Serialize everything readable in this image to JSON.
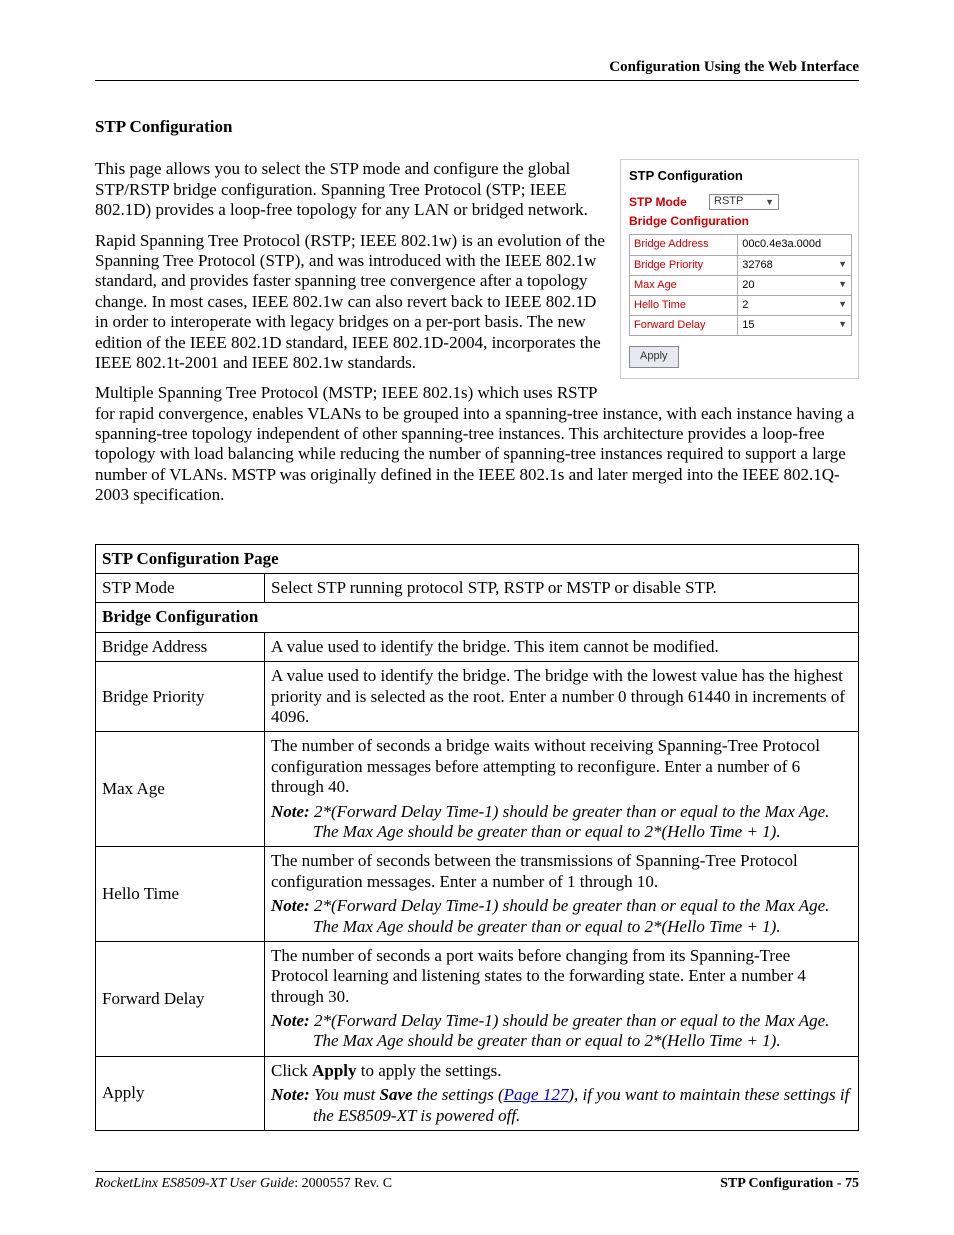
{
  "header": {
    "text": "Configuration Using the Web Interface"
  },
  "heading": "STP Configuration",
  "paragraphs": {
    "p1": "This page allows you to select the STP mode and configure the global STP/RSTP bridge configuration. Spanning Tree Protocol (STP; IEEE 802.1D) provides a loop-free topology for any LAN or bridged network.",
    "p2": "Rapid Spanning Tree Protocol (RSTP; IEEE 802.1w) is an evolution of the Spanning Tree Protocol (STP), and was introduced with the IEEE 802.1w standard, and provides faster spanning tree convergence after a topology change. In most cases, IEEE 802.1w can also revert back to IEEE 802.1D in order to interoperate with legacy bridges on a per-port basis. The new edition of the IEEE 802.1D standard, IEEE 802.1D-2004, incorporates the IEEE 802.1t-2001 and IEEE 802.1w standards.",
    "p3": "Multiple Spanning Tree Protocol (MSTP; IEEE 802.1s) which uses RSTP for rapid convergence, enables VLANs to be grouped into a spanning-tree instance, with each instance having a spanning-tree topology independent of other spanning-tree instances. This architecture provides a loop-free topology with load balancing while reducing the number of spanning-tree instances required to support a large number of VLANs. MSTP was originally defined in the IEEE 802.1s and later merged into the IEEE 802.1Q-2003 specification."
  },
  "figure": {
    "title": "STP Configuration",
    "mode_label": "STP Mode",
    "mode_value": "RSTP",
    "bridge_hdr": "Bridge Configuration",
    "rows": {
      "addr_label": "Bridge Address",
      "addr_value": "00c0.4e3a.000d",
      "prio_label": "Bridge Priority",
      "prio_value": "32768",
      "maxage_label": "Max Age",
      "maxage_value": "20",
      "hello_label": "Hello Time",
      "hello_value": "2",
      "fwd_label": "Forward Delay",
      "fwd_value": "15"
    },
    "apply": "Apply"
  },
  "table": {
    "title": "STP Configuration Page",
    "stp_mode": {
      "label": "STP Mode",
      "desc": "Select STP running protocol STP, RSTP or MSTP or disable STP."
    },
    "bridge_hdr": "Bridge Configuration",
    "bridge_address": {
      "label": "Bridge Address",
      "desc": "A value used to identify the bridge. This item cannot be modified."
    },
    "bridge_priority": {
      "label": "Bridge Priority",
      "desc": "A value used to identify the bridge. The bridge with the lowest value has the highest priority and is selected as the root. Enter a number 0 through 61440 in increments of 4096."
    },
    "max_age": {
      "label": "Max Age",
      "desc": "The number of seconds a bridge waits without receiving Spanning-Tree Protocol configuration messages before attempting to reconfigure. Enter a number of 6 through 40.",
      "note_label": "Note:",
      "note": "2*(Forward Delay Time-1) should be greater than or equal to the Max Age. The Max Age should be greater than or equal to 2*(Hello Time + 1)."
    },
    "hello_time": {
      "label": "Hello Time",
      "desc": "The number of seconds between the transmissions of Spanning-Tree Protocol configuration messages. Enter a number of 1 through 10.",
      "note_label": "Note:",
      "note": "2*(Forward Delay Time-1) should be greater than or equal to the Max Age. The Max Age should be greater than or equal to 2*(Hello Time + 1)."
    },
    "forward_delay": {
      "label": "Forward Delay",
      "desc": "The number of seconds a port waits before changing from its Spanning-Tree Protocol learning and listening states to the forwarding state. Enter a number 4 through 30.",
      "note_label": "Note:",
      "note": "2*(Forward Delay Time-1) should be greater than or equal to the Max Age. The Max Age should be greater than or equal to 2*(Hello Time + 1)."
    },
    "apply": {
      "label": "Apply",
      "desc_pre": "Click ",
      "desc_bold": "Apply",
      "desc_post": " to apply the settings.",
      "note_label": "Note:",
      "note_pre": "You must ",
      "note_bold": "Save",
      "note_mid": " the settings (",
      "note_link": "Page 127",
      "note_post": "), if you want to maintain these settings if the ES8509-XT is powered off."
    }
  },
  "footer": {
    "left_italic": "RocketLinx ES8509-XT User Guide",
    "left_rest": ": 2000557 Rev. C",
    "right": "STP Configuration - 75"
  }
}
